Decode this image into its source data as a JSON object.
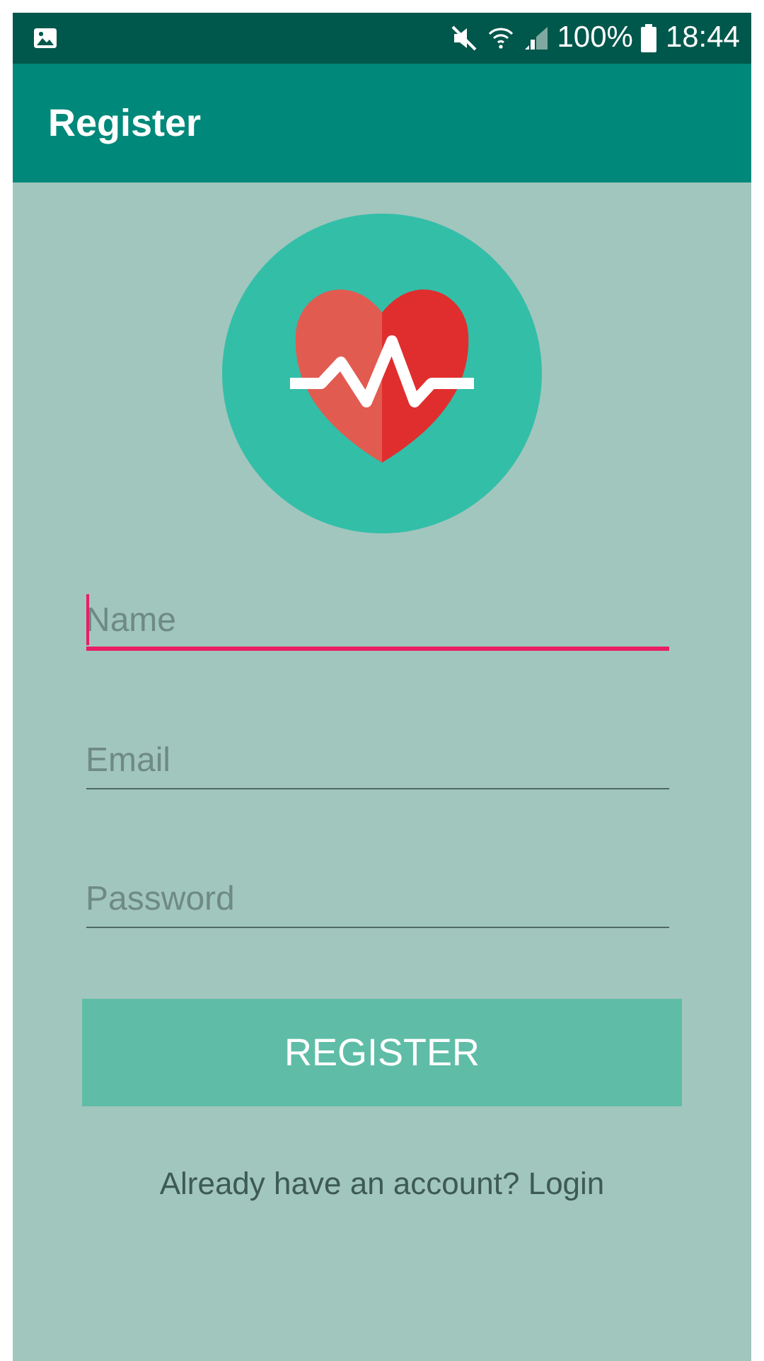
{
  "status_bar": {
    "battery": "100%",
    "time": "18:44"
  },
  "app_bar": {
    "title": "Register"
  },
  "fields": [
    {
      "placeholder": "Name",
      "focused": true
    },
    {
      "placeholder": "Email",
      "focused": false
    },
    {
      "placeholder": "Password",
      "focused": false
    }
  ],
  "register_button": "REGISTER",
  "login_prompt": "Already have an account? Login"
}
